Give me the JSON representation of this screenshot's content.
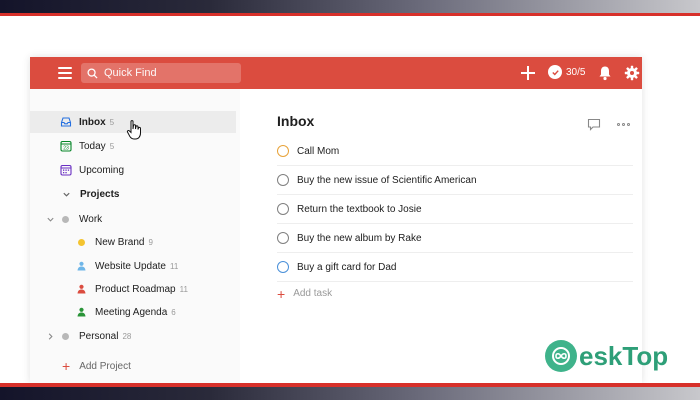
{
  "topbar": {
    "search_placeholder": "Quick Find",
    "karma": "30/5"
  },
  "sidebar": {
    "inbox": {
      "label": "Inbox",
      "count": "5"
    },
    "today": {
      "label": "Today",
      "count": "5"
    },
    "upcoming": {
      "label": "Upcoming"
    },
    "projects_header": "Projects",
    "work": {
      "label": "Work"
    },
    "projects": [
      {
        "label": "New Brand",
        "count": "9",
        "color": "#f4c430"
      },
      {
        "label": "Website Update",
        "count": "11",
        "color": "#6fb6e8"
      },
      {
        "label": "Product Roadmap",
        "count": "11",
        "color": "#db4c3f"
      },
      {
        "label": "Meeting Agenda",
        "count": "6",
        "color": "#299438"
      }
    ],
    "personal": {
      "label": "Personal",
      "count": "28"
    },
    "add_project": "Add Project"
  },
  "main": {
    "title": "Inbox",
    "tasks": [
      {
        "text": "Call Mom"
      },
      {
        "text": "Buy the new issue of Scientific American"
      },
      {
        "text": "Return the textbook to Josie"
      },
      {
        "text": "Buy the new album by Rake"
      },
      {
        "text": "Buy a gift card for Dad"
      }
    ],
    "add_task": "Add task"
  },
  "watermark": {
    "text": "eskTop"
  },
  "colors": {
    "brand": "#db4c3f",
    "priority_orange": "#e8a33a",
    "priority_blue": "#4a90d9"
  }
}
